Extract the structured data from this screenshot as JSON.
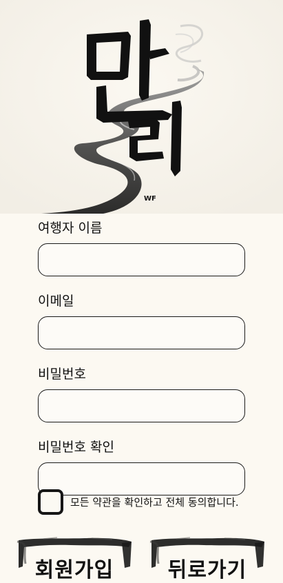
{
  "hero": {
    "logo_title": "만리",
    "signature": "WF"
  },
  "form": {
    "name_label": "여행자 이름",
    "name_value": "",
    "email_label": "이메일",
    "email_value": "",
    "password_label": "비밀번호",
    "password_value": "",
    "password_confirm_label": "비밀번호 확인",
    "password_confirm_value": ""
  },
  "agree": {
    "checked": false,
    "text": "모든 약관을 확인하고 전체 동의합니다."
  },
  "buttons": {
    "signup_label": "회원가입",
    "back_label": "뒤로가기"
  }
}
